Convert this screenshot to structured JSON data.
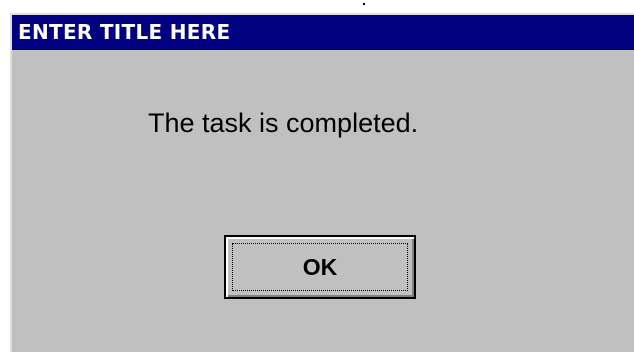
{
  "dialog": {
    "title": "ENTER TITLE HERE",
    "message": "The task is completed.",
    "ok_label": "OK"
  },
  "colors": {
    "title_bar": "#000080",
    "title_text": "#ffffff",
    "dialog_background": "#c0c0c0"
  }
}
